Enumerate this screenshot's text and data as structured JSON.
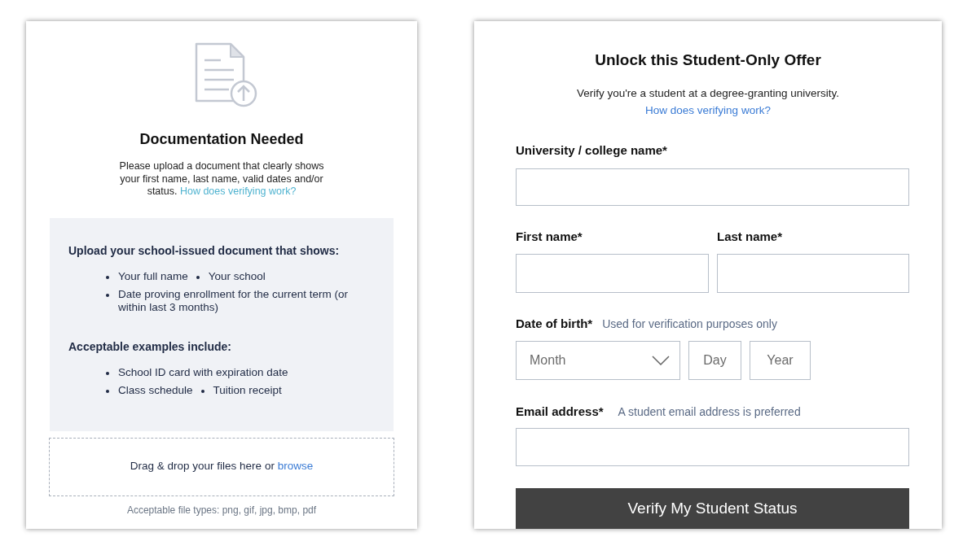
{
  "upload_card": {
    "title": "Documentation Needed",
    "intro": "Please upload a document that clearly shows your first name, last name, valid dates and/or status.",
    "intro_link": "How does verifying work?",
    "requirements_heading": "Upload your school-issued document that shows:",
    "requirements": [
      {
        "items": [
          "Your full name",
          "Your school"
        ]
      },
      {
        "items": [
          "Date proving enrollment for the current term (or within last 3 months)"
        ]
      }
    ],
    "examples_heading": "Acceptable examples include:",
    "examples": [
      {
        "items": [
          "School ID card with expiration date"
        ]
      },
      {
        "items": [
          "Class schedule",
          "Tuition receipt"
        ]
      }
    ],
    "dropzone_text": "Drag & drop your files here or",
    "dropzone_link": "browse",
    "file_types": "Acceptable file types: png, gif, jpg, bmp, pdf"
  },
  "verify_form": {
    "title": "Unlock this Student-Only Offer",
    "subtitle": "Verify you're a student at a degree-granting university.",
    "subtitle_link": "How does verifying work?",
    "university_label": "University / college name*",
    "first_name_label": "First name*",
    "last_name_label": "Last name*",
    "dob_label": "Date of birth*",
    "dob_hint": "Used for verification purposes only",
    "month_placeholder": "Month",
    "day_placeholder": "Day",
    "year_placeholder": "Year",
    "email_label": "Email address*",
    "email_hint": "A student email address is preferred",
    "submit": "Verify My Student Status"
  }
}
